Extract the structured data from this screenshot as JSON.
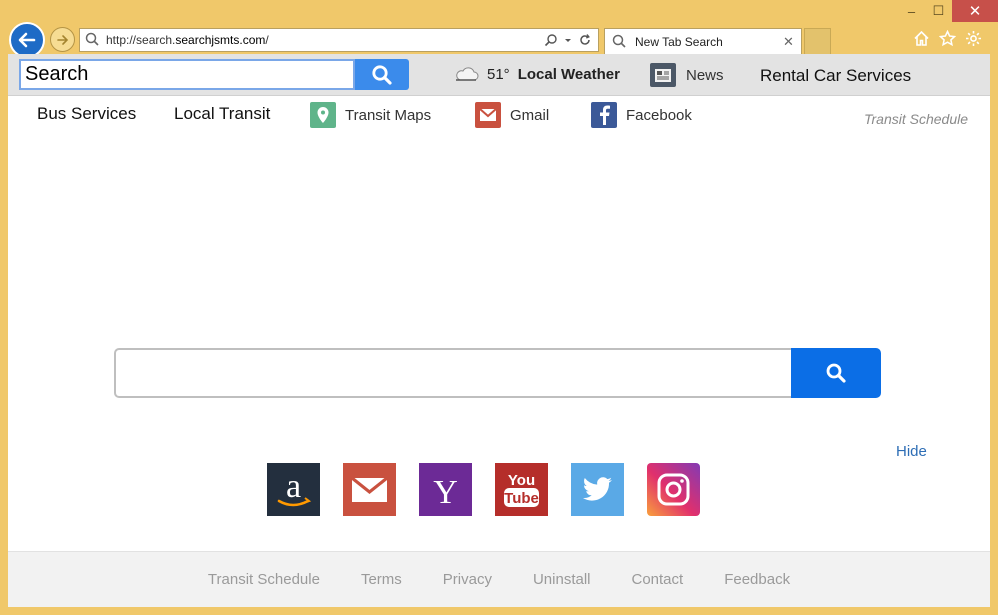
{
  "browser": {
    "address": "http://search.searchjsmts.com/",
    "address_prefix": "http://search.",
    "address_domain": "searchjsmts.com",
    "address_suffix": "/",
    "tab_title": "New Tab Search",
    "window_buttons": {
      "minimize": "–",
      "maximize": "☐",
      "close": "✕"
    }
  },
  "toolbar": {
    "search_value": "Search",
    "weather_temp": "51°",
    "weather_label": "Local Weather",
    "news_label": "News",
    "rental_label": "Rental Car Services"
  },
  "links": {
    "bus": "Bus Services",
    "local_transit": "Local Transit",
    "transit_maps": "Transit Maps",
    "gmail": "Gmail",
    "facebook": "Facebook",
    "transit_schedule": "Transit Schedule"
  },
  "main": {
    "search_placeholder": "",
    "hide_label": "Hide"
  },
  "shortcuts": [
    {
      "name": "amazon-icon",
      "color": "#232f3e"
    },
    {
      "name": "gmail-icon",
      "color": "#c9513f"
    },
    {
      "name": "yahoo-icon",
      "color": "#6c2a96"
    },
    {
      "name": "youtube-icon",
      "color": "#b52e2a"
    },
    {
      "name": "twitter-icon",
      "color": "#5aa9e6"
    },
    {
      "name": "instagram-icon",
      "color": "#c13584"
    }
  ],
  "footer": {
    "items": [
      "Transit Schedule",
      "Terms",
      "Privacy",
      "Uninstall",
      "Contact",
      "Feedback"
    ]
  },
  "colors": {
    "frame": "#f0c86a",
    "accent": "#0b6ee6",
    "toolbar_button": "#3b8beb"
  }
}
